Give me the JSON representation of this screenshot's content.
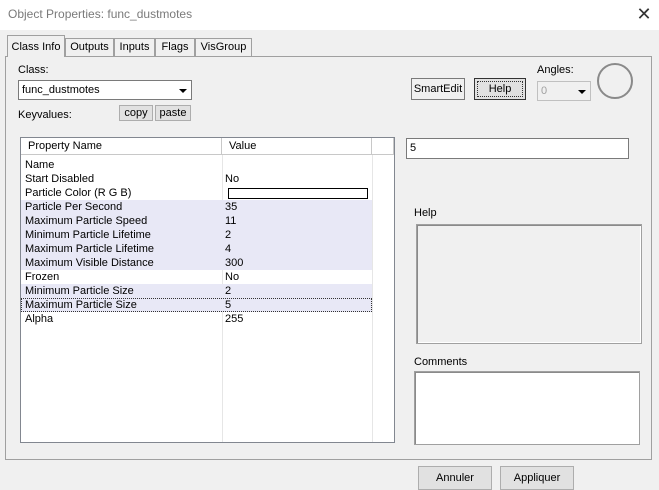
{
  "window": {
    "title": "Object Properties: func_dustmotes"
  },
  "tabs": [
    {
      "label": "Class Info",
      "active": true
    },
    {
      "label": "Outputs"
    },
    {
      "label": "Inputs"
    },
    {
      "label": "Flags"
    },
    {
      "label": "VisGroup"
    }
  ],
  "class_section": {
    "label": "Class:",
    "value": "func_dustmotes",
    "keyvalues_label": "Keyvalues:",
    "copy_label": "copy",
    "paste_label": "paste"
  },
  "toolbar": {
    "smartedit_label": "SmartEdit",
    "help_label": "Help",
    "angles_label": "Angles:",
    "angles_value": "0"
  },
  "table": {
    "headers": [
      "Property Name",
      "Value"
    ],
    "rows": [
      {
        "name": "Name",
        "value": ""
      },
      {
        "name": "Start Disabled",
        "value": "No"
      },
      {
        "name": "Particle Color (R G B)",
        "value": ""
      },
      {
        "name": "Particle Per Second",
        "value": "35"
      },
      {
        "name": "Maximum Particle Speed",
        "value": "11"
      },
      {
        "name": "Minimum Particle Lifetime",
        "value": "2"
      },
      {
        "name": "Maximum Particle Lifetime",
        "value": "4"
      },
      {
        "name": "Maximum Visible Distance",
        "value": "300"
      },
      {
        "name": "Frozen",
        "value": "No"
      },
      {
        "name": "Minimum Particle Size",
        "value": "2"
      },
      {
        "name": "Maximum Particle Size",
        "value": "5"
      },
      {
        "name": "Alpha",
        "value": "255"
      }
    ]
  },
  "value_field": {
    "value": "5"
  },
  "help_panel": {
    "label": "Help"
  },
  "comments_panel": {
    "label": "Comments"
  },
  "footer": {
    "cancel_label": "Annuler",
    "apply_label": "Appliquer"
  }
}
